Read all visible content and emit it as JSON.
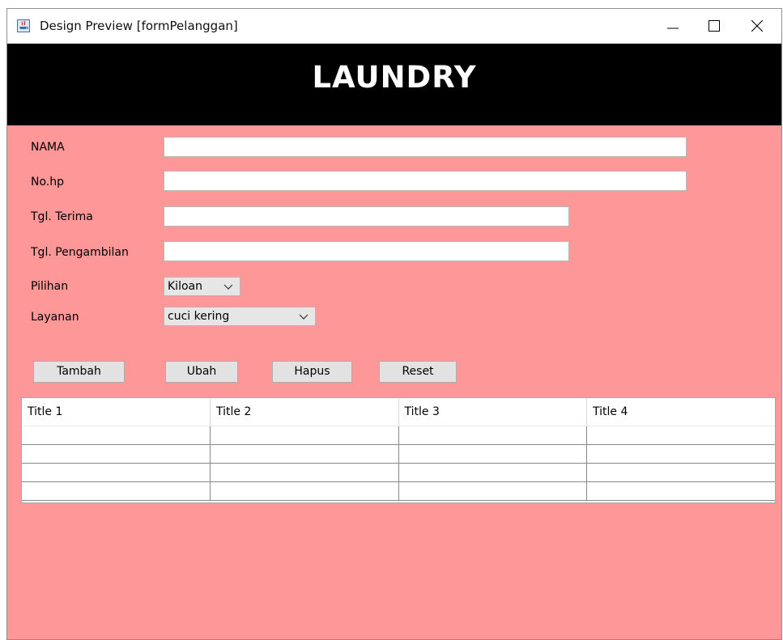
{
  "window": {
    "title": "Design Preview [formPelanggan]",
    "background_color": "#fe9898",
    "controls": {
      "minimize_icon": "minimize-icon",
      "maximize_icon": "maximize-icon",
      "close_icon": "close-icon"
    }
  },
  "header": {
    "title": "LAUNDRY",
    "background_color": "#000000"
  },
  "form": {
    "nama": {
      "label": "NAMA",
      "value": ""
    },
    "nohp": {
      "label": "No.hp",
      "value": ""
    },
    "tgl_terima": {
      "label": "Tgl. Terima",
      "value": ""
    },
    "tgl_pengambilan": {
      "label": "Tgl. Pengambilan",
      "value": ""
    },
    "pilihan": {
      "label": "Pilihan",
      "selected": "Kiloan"
    },
    "layanan": {
      "label": "Layanan",
      "selected": "cuci kering"
    }
  },
  "buttons": {
    "tambah": "Tambah",
    "ubah": "Ubah",
    "hapus": "Hapus",
    "reset": "Reset"
  },
  "table": {
    "columns": [
      "Title 1",
      "Title 2",
      "Title 3",
      "Title 4"
    ],
    "rows": [
      [
        "",
        "",
        "",
        ""
      ],
      [
        "",
        "",
        "",
        ""
      ],
      [
        "",
        "",
        "",
        ""
      ],
      [
        "",
        "",
        "",
        ""
      ]
    ]
  }
}
